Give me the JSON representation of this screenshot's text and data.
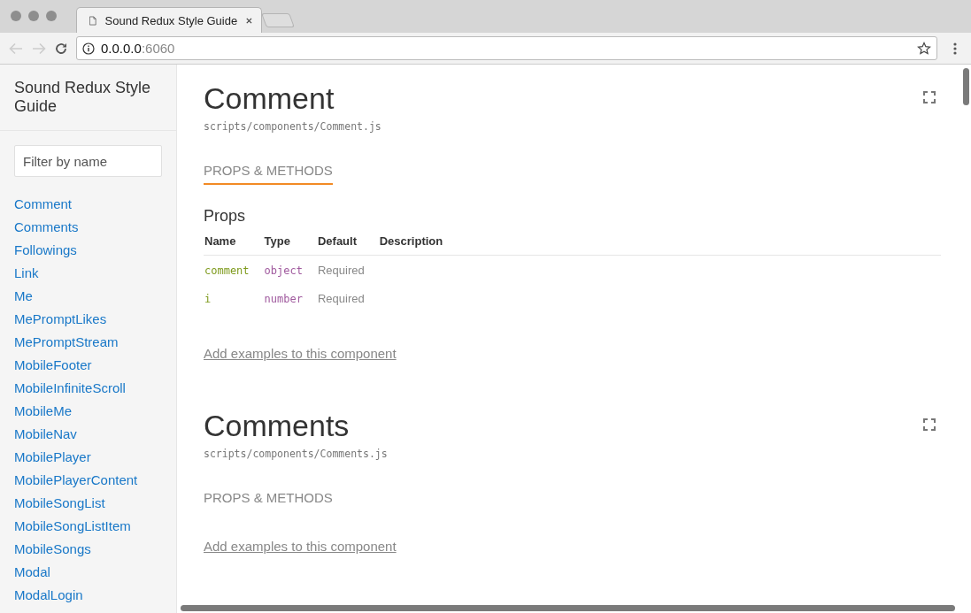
{
  "browser": {
    "tab_title": "Sound Redux Style Guide",
    "url_host": "0.0.0.0",
    "url_port": ":6060"
  },
  "sidebar": {
    "title": "Sound Redux Style Guide",
    "filter": {
      "placeholder": "Filter by name"
    },
    "items": [
      "Comment",
      "Comments",
      "Followings",
      "Link",
      "Me",
      "MePromptLikes",
      "MePromptStream",
      "MobileFooter",
      "MobileInfiniteScroll",
      "MobileMe",
      "MobileNav",
      "MobilePlayer",
      "MobilePlayerContent",
      "MobileSongList",
      "MobileSongListItem",
      "MobileSongs",
      "Modal",
      "ModalLogin"
    ]
  },
  "sections": [
    {
      "name": "Comment",
      "path": "scripts/components/Comment.js",
      "tab": {
        "label": "PROPS & METHODS",
        "selected": true
      },
      "props": {
        "title": "Props",
        "columns": [
          "Name",
          "Type",
          "Default",
          "Description"
        ],
        "rows": [
          {
            "name": "comment",
            "type": "object",
            "default": "Required"
          },
          {
            "name": "i",
            "type": "number",
            "default": "Required"
          }
        ]
      },
      "link": "Add examples to this component"
    },
    {
      "name": "Comments",
      "path": "scripts/components/Comments.js",
      "tab": {
        "label": "PROPS & METHODS",
        "selected": false
      },
      "link": "Add examples to this component"
    }
  ]
}
